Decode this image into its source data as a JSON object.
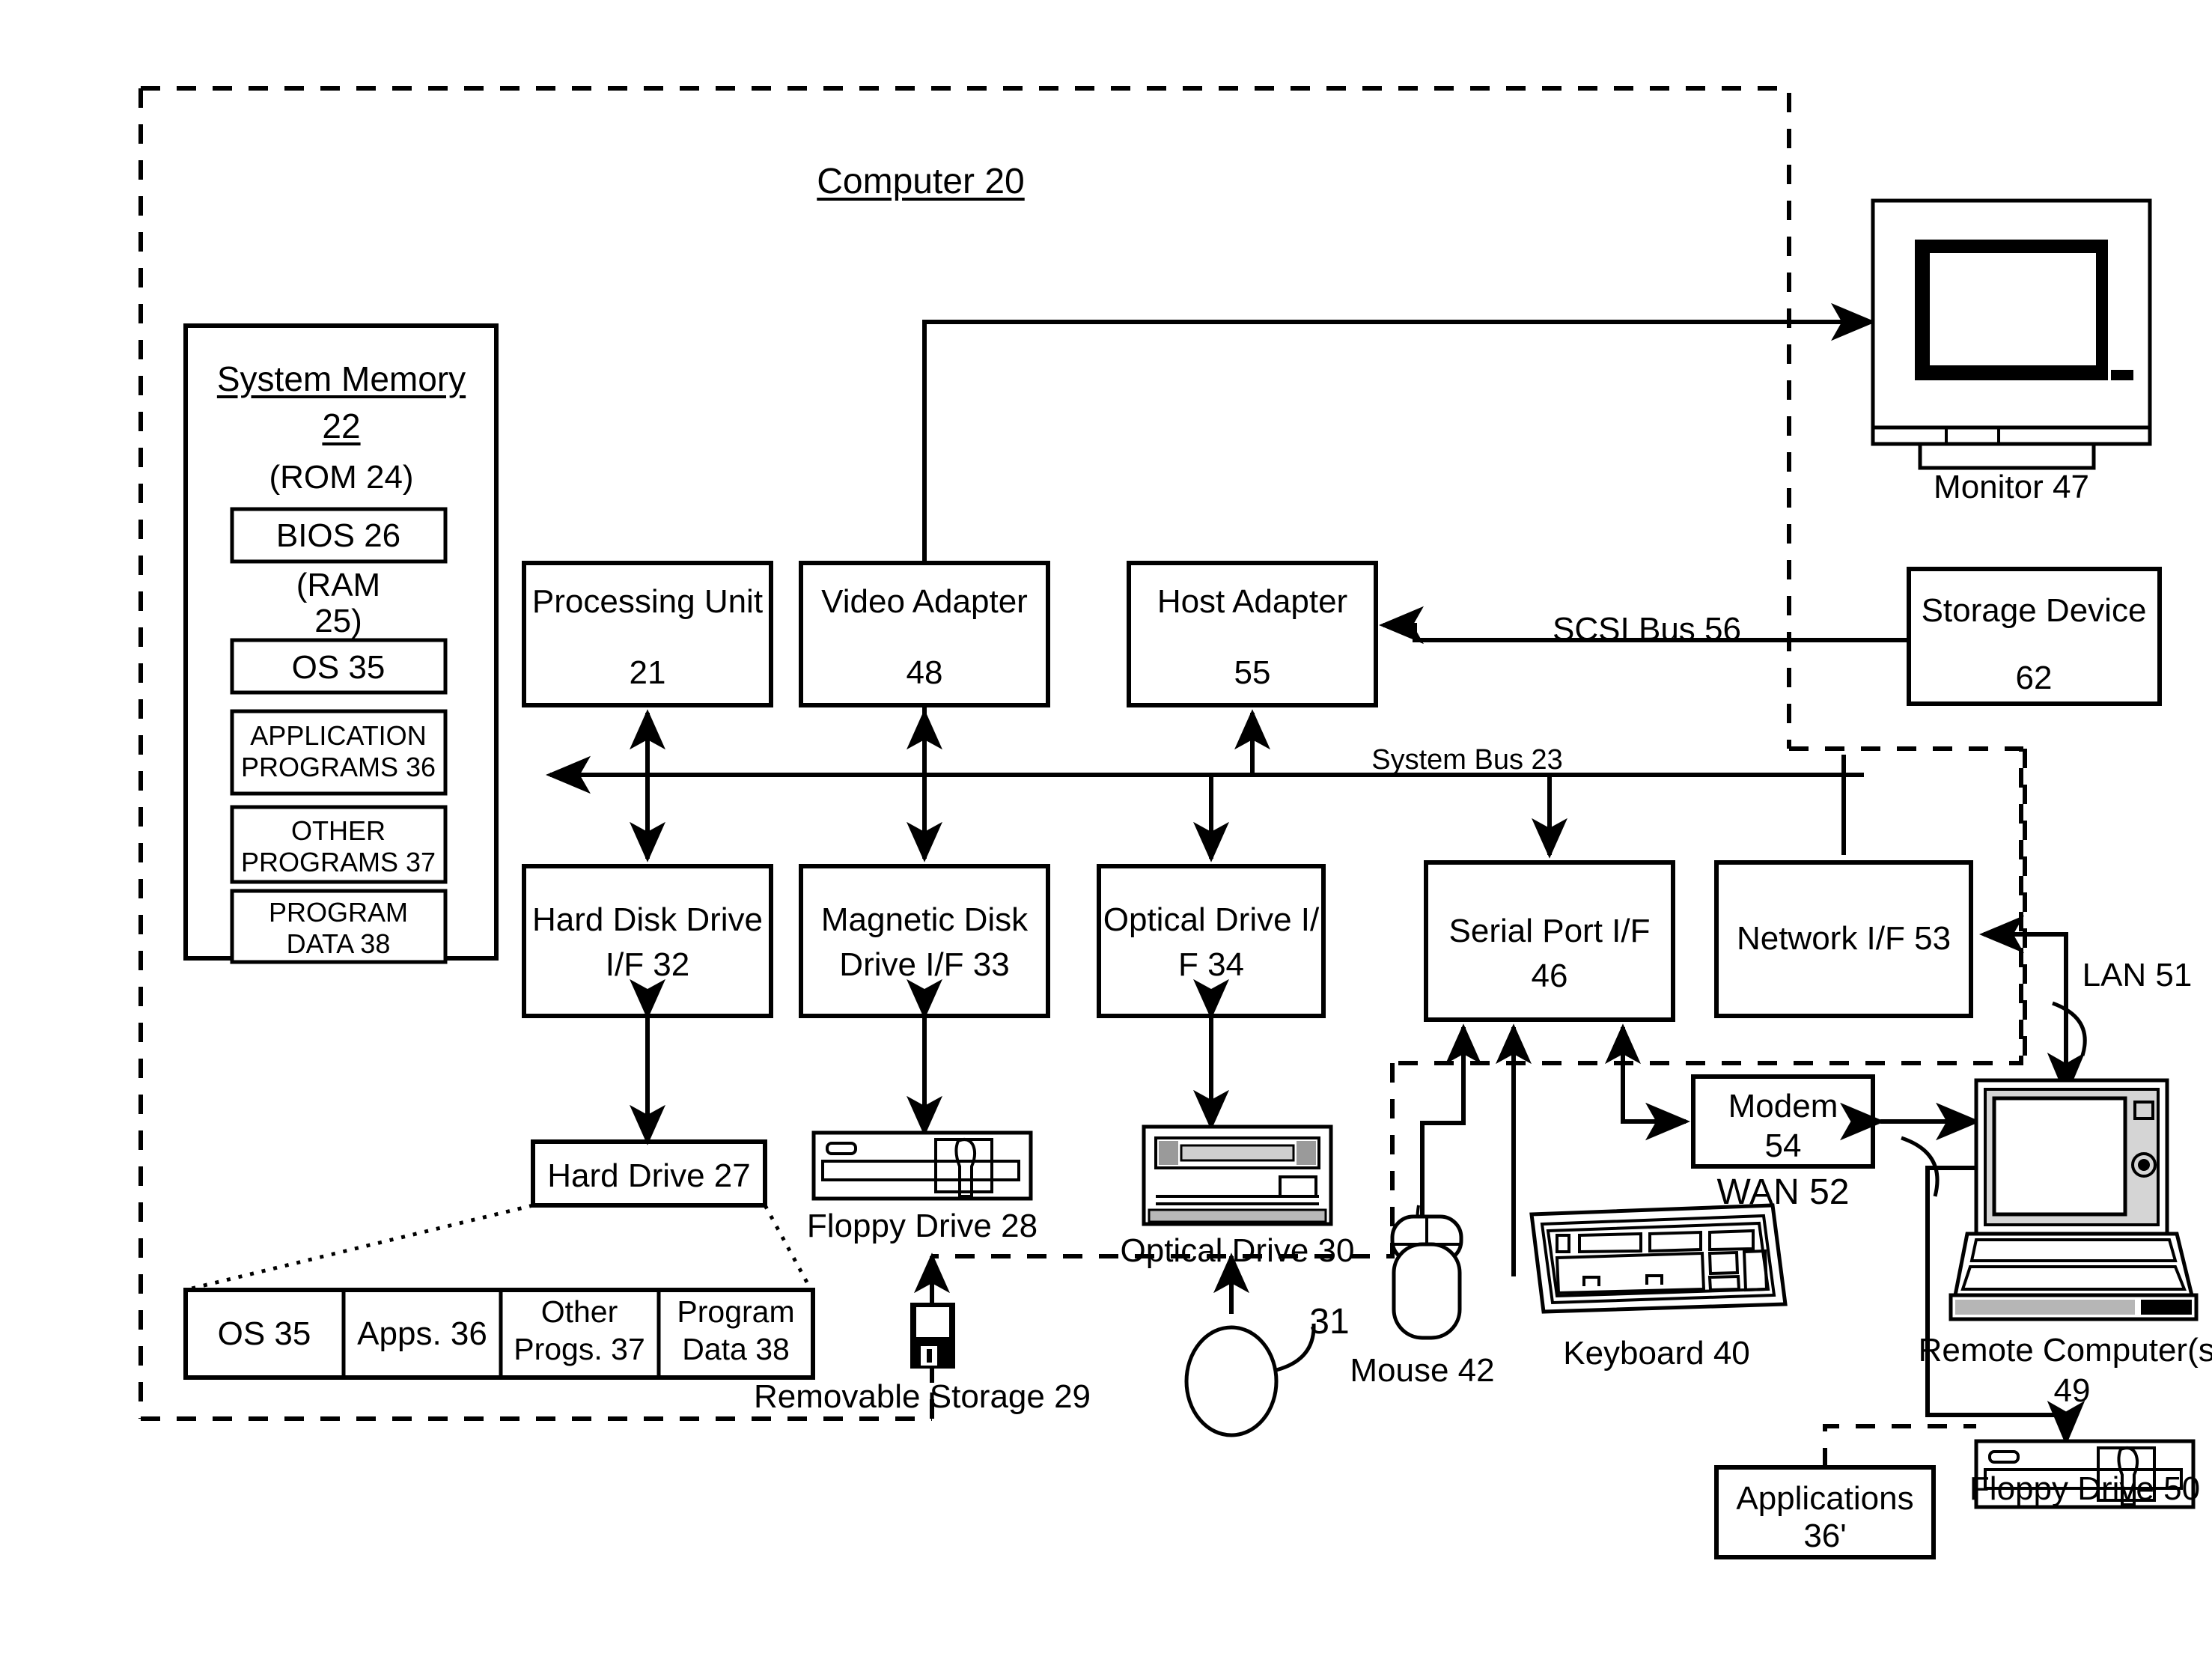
{
  "figure": {
    "title": "Computer 20",
    "system_bus_label": "System Bus 23",
    "scsi_bus_label": "SCSI Bus 56",
    "lan_label": "LAN 51",
    "wan_label": "WAN 52",
    "pointer_31": "31"
  },
  "system_memory": {
    "title": "System Memory",
    "number": "22",
    "rom_label": "(ROM 24)",
    "bios_label": "BIOS 26",
    "ram_label_line1": "(RAM",
    "ram_label_line2": "25)",
    "os_label": "OS 35",
    "application_programs": "APPLICATION PROGRAMS 36",
    "other_programs": "OTHER PROGRAMS 37",
    "program_data": "PROGRAM DATA 38"
  },
  "blocks": {
    "processing_unit": {
      "name": "Processing Unit",
      "number": "21"
    },
    "video_adapter": {
      "name": "Video Adapter",
      "number": "48"
    },
    "host_adapter": {
      "name": "Host Adapter",
      "number": "55"
    },
    "storage_device": {
      "name": "Storage Device",
      "number": "62"
    },
    "hard_disk_drive_if": {
      "name": "Hard Disk Drive",
      "number": "I/F 32"
    },
    "magnetic_disk_drive_if": {
      "name": "Magnetic Disk",
      "number": "Drive I/F 33"
    },
    "optical_drive_if": {
      "name": "Optical Drive I/",
      "number": "F 34"
    },
    "serial_port_if": {
      "name": "Serial Port I/F",
      "number": "46"
    },
    "network_if": {
      "name": "Network I/F 53"
    },
    "modem": {
      "name": "Modem",
      "number": "54"
    },
    "applications_remote": {
      "name": "Applications",
      "number": "36'"
    },
    "hard_drive": {
      "name": "Hard Drive 27"
    }
  },
  "hard_drive_partitions": [
    {
      "label": "OS 35"
    },
    {
      "label": "Apps. 36"
    },
    {
      "line1": "Other",
      "line2": "Progs. 37"
    },
    {
      "line1": "Program",
      "line2": "Data 38"
    }
  ],
  "peripherals": {
    "monitor": "Monitor 47",
    "floppy_drive_28": "Floppy Drive 28",
    "removable_storage": "Removable Storage 29",
    "optical_drive_30": "Optical Drive 30",
    "mouse": "Mouse 42",
    "keyboard": "Keyboard 40",
    "remote_computer_line1": "Remote Computer(s)",
    "remote_computer_line2": "49",
    "floppy_drive_50": "Floppy Drive 50"
  },
  "icons": {
    "monitor": "crt-monitor-icon",
    "floppy_drive": "floppy-drive-icon",
    "diskette": "diskette-icon",
    "optical_drive": "optical-drive-icon",
    "mouse": "mouse-icon",
    "keyboard": "keyboard-icon",
    "laptop": "laptop-icon",
    "floppy_drive_50": "floppy-drive-icon",
    "circle_31": "circle-callout-icon"
  },
  "colors": {
    "ink": "#000000",
    "paper": "#ffffff"
  }
}
